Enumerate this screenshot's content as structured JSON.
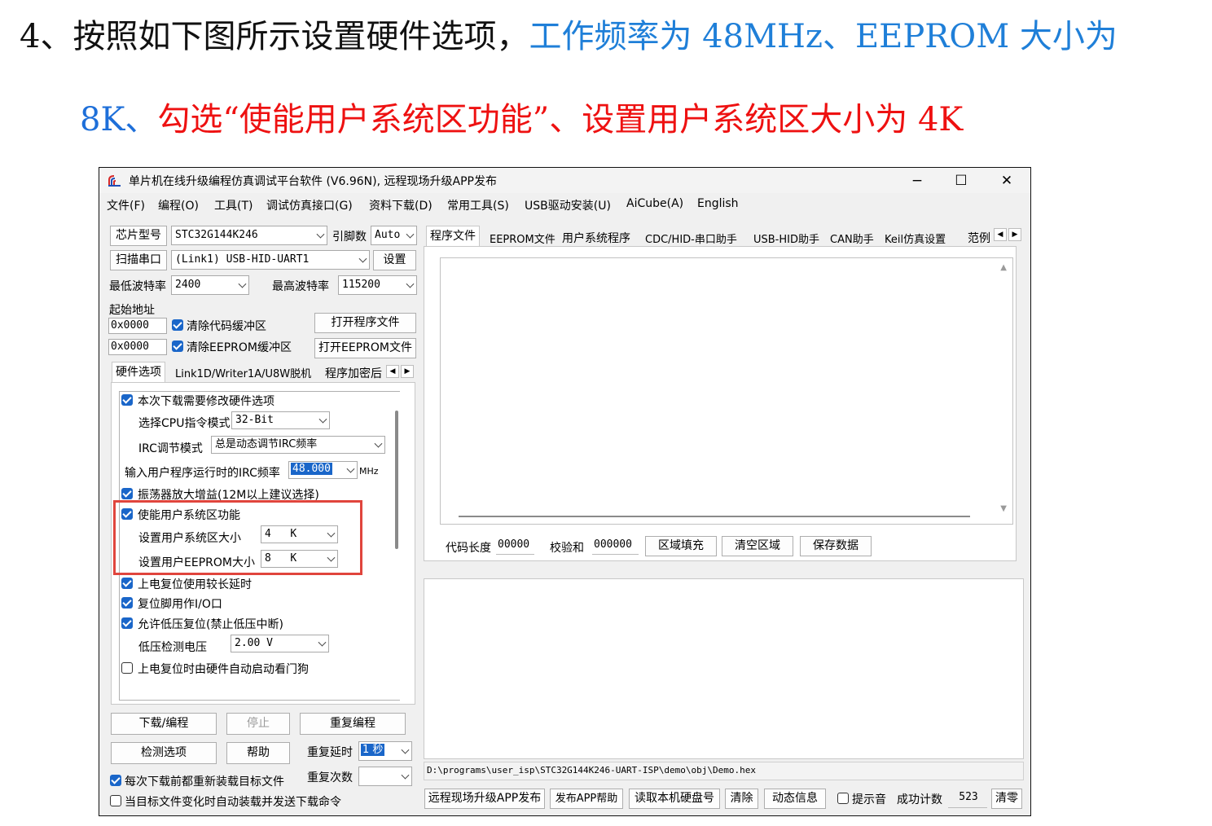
{
  "doc": {
    "line1_black": "4、按照如下图所示设置硬件选项，",
    "line1_blue": "工作频率为 48MHz、EEPROM 大小为",
    "line2_blue": "8K、",
    "line2_red": "勾选“使能用户系统区功能”、设置用户系统区大小为 4K"
  },
  "window": {
    "title": "单片机在线升级编程仿真调试平台软件 (V6.96N), 远程现场升级APP发布",
    "controls": {
      "minimize": "−",
      "maximize": "☐",
      "close": "✕"
    },
    "menu": [
      "文件(F)",
      "编程(O)",
      "工具(T)",
      "调试仿真接口(G)",
      "资料下载(D)",
      "常用工具(S)",
      "USB驱动安装(U)",
      "AiCube(A)",
      "English"
    ]
  },
  "left": {
    "chip_btn": "芯片型号",
    "chip_value": "STC32G144K246",
    "pins_label": "引脚数",
    "pins_value": "Auto",
    "scan_btn": "扫描串口",
    "port_value": "(Link1) USB-HID-UART1",
    "settings_btn": "设置",
    "min_baud_label": "最低波特率",
    "min_baud_value": "2400",
    "max_baud_label": "最高波特率",
    "max_baud_value": "115200",
    "start_addr_label": "起始地址",
    "addr1": "0x0000",
    "addr2": "0x0000",
    "clear_code": "清除代码缓冲区",
    "clear_eeprom": "清除EEPROM缓冲区",
    "open_prog": "打开程序文件",
    "open_eeprom": "打开EEPROM文件",
    "tabs": [
      "硬件选项",
      "Link1D/Writer1A/U8W脱机",
      "程序加密后"
    ],
    "hw": {
      "need_modify": "本次下载需要修改硬件选项",
      "cpu_mode_label": "选择CPU指令模式",
      "cpu_mode_value": "32-Bit",
      "irc_mode_label": "IRC调节模式",
      "irc_mode_value": "总是动态调节IRC频率",
      "irc_freq_label": "输入用户程序运行时的IRC频率",
      "irc_freq_value": "48.000",
      "irc_freq_unit": "MHz",
      "osc_gain": "振荡器放大增益(12M以上建议选择)",
      "enable_user_sys": "使能用户系统区功能",
      "user_sys_size_label": "设置用户系统区大小",
      "user_sys_size_value": "4",
      "user_sys_size_unit": "K",
      "user_eeprom_label": "设置用户EEPROM大小",
      "user_eeprom_value": "8",
      "user_eeprom_unit": "K",
      "long_delay": "上电复位使用较长延时",
      "reset_io": "复位脚用作I/O口",
      "low_volt_reset": "允许低压复位(禁止低压中断)",
      "low_volt_label": "低压检测电压",
      "low_volt_value": "2.00 V",
      "watchdog": "上电复位时由硬件自动启动看门狗"
    },
    "download_btn": "下载/编程",
    "stop_btn": "停止",
    "reprog_btn": "重复编程",
    "check_btn": "检测选项",
    "help_btn": "帮助",
    "repeat_delay_label": "重复延时",
    "repeat_delay_value": "1 秒",
    "repeat_count_label": "重复次数",
    "reload_each": "每次下载前都重新装载目标文件",
    "auto_reload": "当目标文件变化时自动装载并发送下载命令"
  },
  "right": {
    "tabs": [
      "程序文件",
      "EEPROM文件",
      "用户系统程序",
      "CDC/HID-串口助手",
      "USB-HID助手",
      "CAN助手",
      "Keil仿真设置",
      "范例"
    ],
    "code_len_label": "代码长度",
    "code_len_value": "00000",
    "checksum_label": "校验和",
    "checksum_value": "000000",
    "fill_btn": "区域填充",
    "clear_btn": "清空区域",
    "save_btn": "保存数据",
    "path": "D:\\programs\\user_isp\\STC32G144K246-UART-ISP\\demo\\obj\\Demo.hex",
    "bottom": {
      "remote_app": "远程现场升级APP发布",
      "app_help": "发布APP帮助",
      "read_disk": "读取本机硬盘号",
      "clear": "清除",
      "dyn_info": "动态信息",
      "beep": "提示音",
      "success_label": "成功计数",
      "success_value": "523",
      "reset_count": "清零"
    }
  },
  "colors": {
    "highlight": "#e0453d",
    "checkbox": "#1a66c9",
    "blue_text": "#1f7fd8",
    "red_text": "#ee1111"
  }
}
